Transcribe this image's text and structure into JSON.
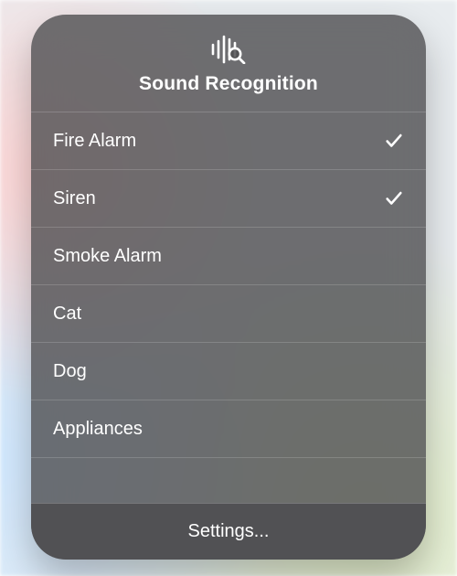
{
  "header": {
    "title": "Sound Recognition",
    "icon_name": "sound-recognition-icon"
  },
  "sounds": [
    {
      "label": "Fire Alarm",
      "enabled": true
    },
    {
      "label": "Siren",
      "enabled": true
    },
    {
      "label": "Smoke Alarm",
      "enabled": false
    },
    {
      "label": "Cat",
      "enabled": false
    },
    {
      "label": "Dog",
      "enabled": false
    },
    {
      "label": "Appliances",
      "enabled": false
    }
  ],
  "footer": {
    "settings_label": "Settings..."
  }
}
